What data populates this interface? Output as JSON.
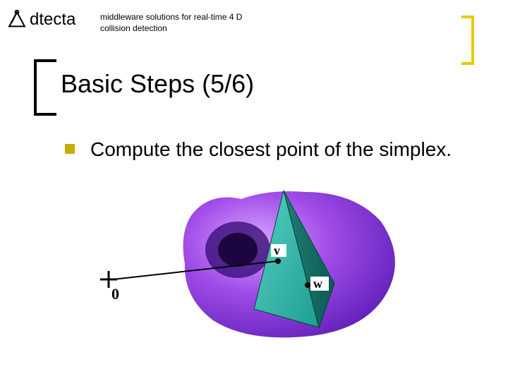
{
  "logo": {
    "text": "dtecta"
  },
  "tagline": "middleware solutions for real-time 4 D collision detection",
  "title": "Basic Steps (5/6)",
  "bullet": "Compute the closest point of the simplex.",
  "figure": {
    "origin_label": "0",
    "label_v": "v",
    "label_w": "w"
  }
}
